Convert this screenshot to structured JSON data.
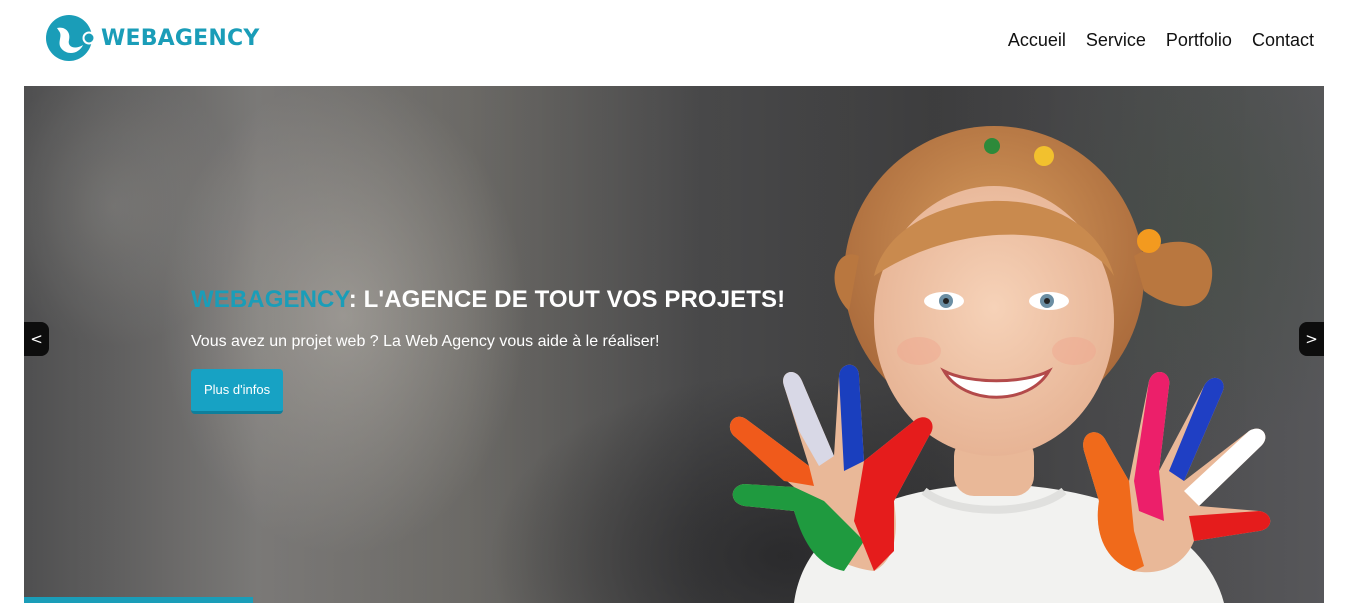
{
  "brand": {
    "name": "WEBAGENCY",
    "color": "#1a9db8"
  },
  "nav": {
    "items": [
      {
        "label": "Accueil"
      },
      {
        "label": "Service"
      },
      {
        "label": "Portfolio"
      },
      {
        "label": "Contact"
      }
    ]
  },
  "hero": {
    "title_accent": "WEBAGENCY",
    "title_rest": ": L'AGENCE DE TOUT VOS PROJETS!",
    "subtitle": "Vous avez un projet web ? La Web Agency vous aide à le réaliser!",
    "button_label": "Plus d'infos",
    "prev_label": "<",
    "next_label": ">",
    "slide_progress": 0.176
  },
  "icons": {
    "logo": "webagency-logo-icon",
    "prev": "chevron-left-icon",
    "next": "chevron-right-icon"
  },
  "colors": {
    "accent": "#1a9db8",
    "button": "#17a2c4",
    "text_dark": "#111111"
  }
}
